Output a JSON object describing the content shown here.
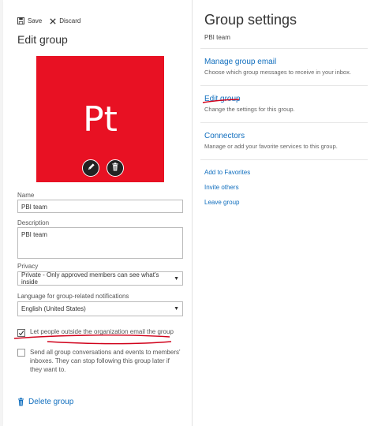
{
  "toolbar": {
    "save_label": "Save",
    "discard_label": "Discard"
  },
  "left": {
    "title": "Edit group",
    "photo": {
      "initials": "Pt",
      "color": "#e81123"
    },
    "name": {
      "label": "Name",
      "value": "PBI team"
    },
    "description": {
      "label": "Description",
      "value": "PBI team"
    },
    "privacy": {
      "label": "Privacy",
      "value": "Private - Only approved members can see what's inside"
    },
    "language": {
      "label": "Language for group-related notifications",
      "value": "English (United States)"
    },
    "checkbox_external": {
      "label": "Let people outside the organization email the group",
      "checked": true
    },
    "checkbox_send": {
      "label": "Send all group conversations and events to members' inboxes. They can stop following this group later if they want to.",
      "checked": false
    },
    "delete_label": "Delete group"
  },
  "right": {
    "title": "Group settings",
    "subtitle": "PBI team",
    "items": [
      {
        "label": "Manage group email",
        "desc": "Choose which group messages to receive in your inbox."
      },
      {
        "label": "Edit group",
        "desc": "Change the settings for this group."
      },
      {
        "label": "Connectors",
        "desc": "Manage or add your favorite services to this group."
      }
    ],
    "links": [
      "Add to Favorites",
      "Invite others",
      "Leave group"
    ]
  },
  "colors": {
    "accent": "#106ebe",
    "annotation": "#d0021b"
  }
}
